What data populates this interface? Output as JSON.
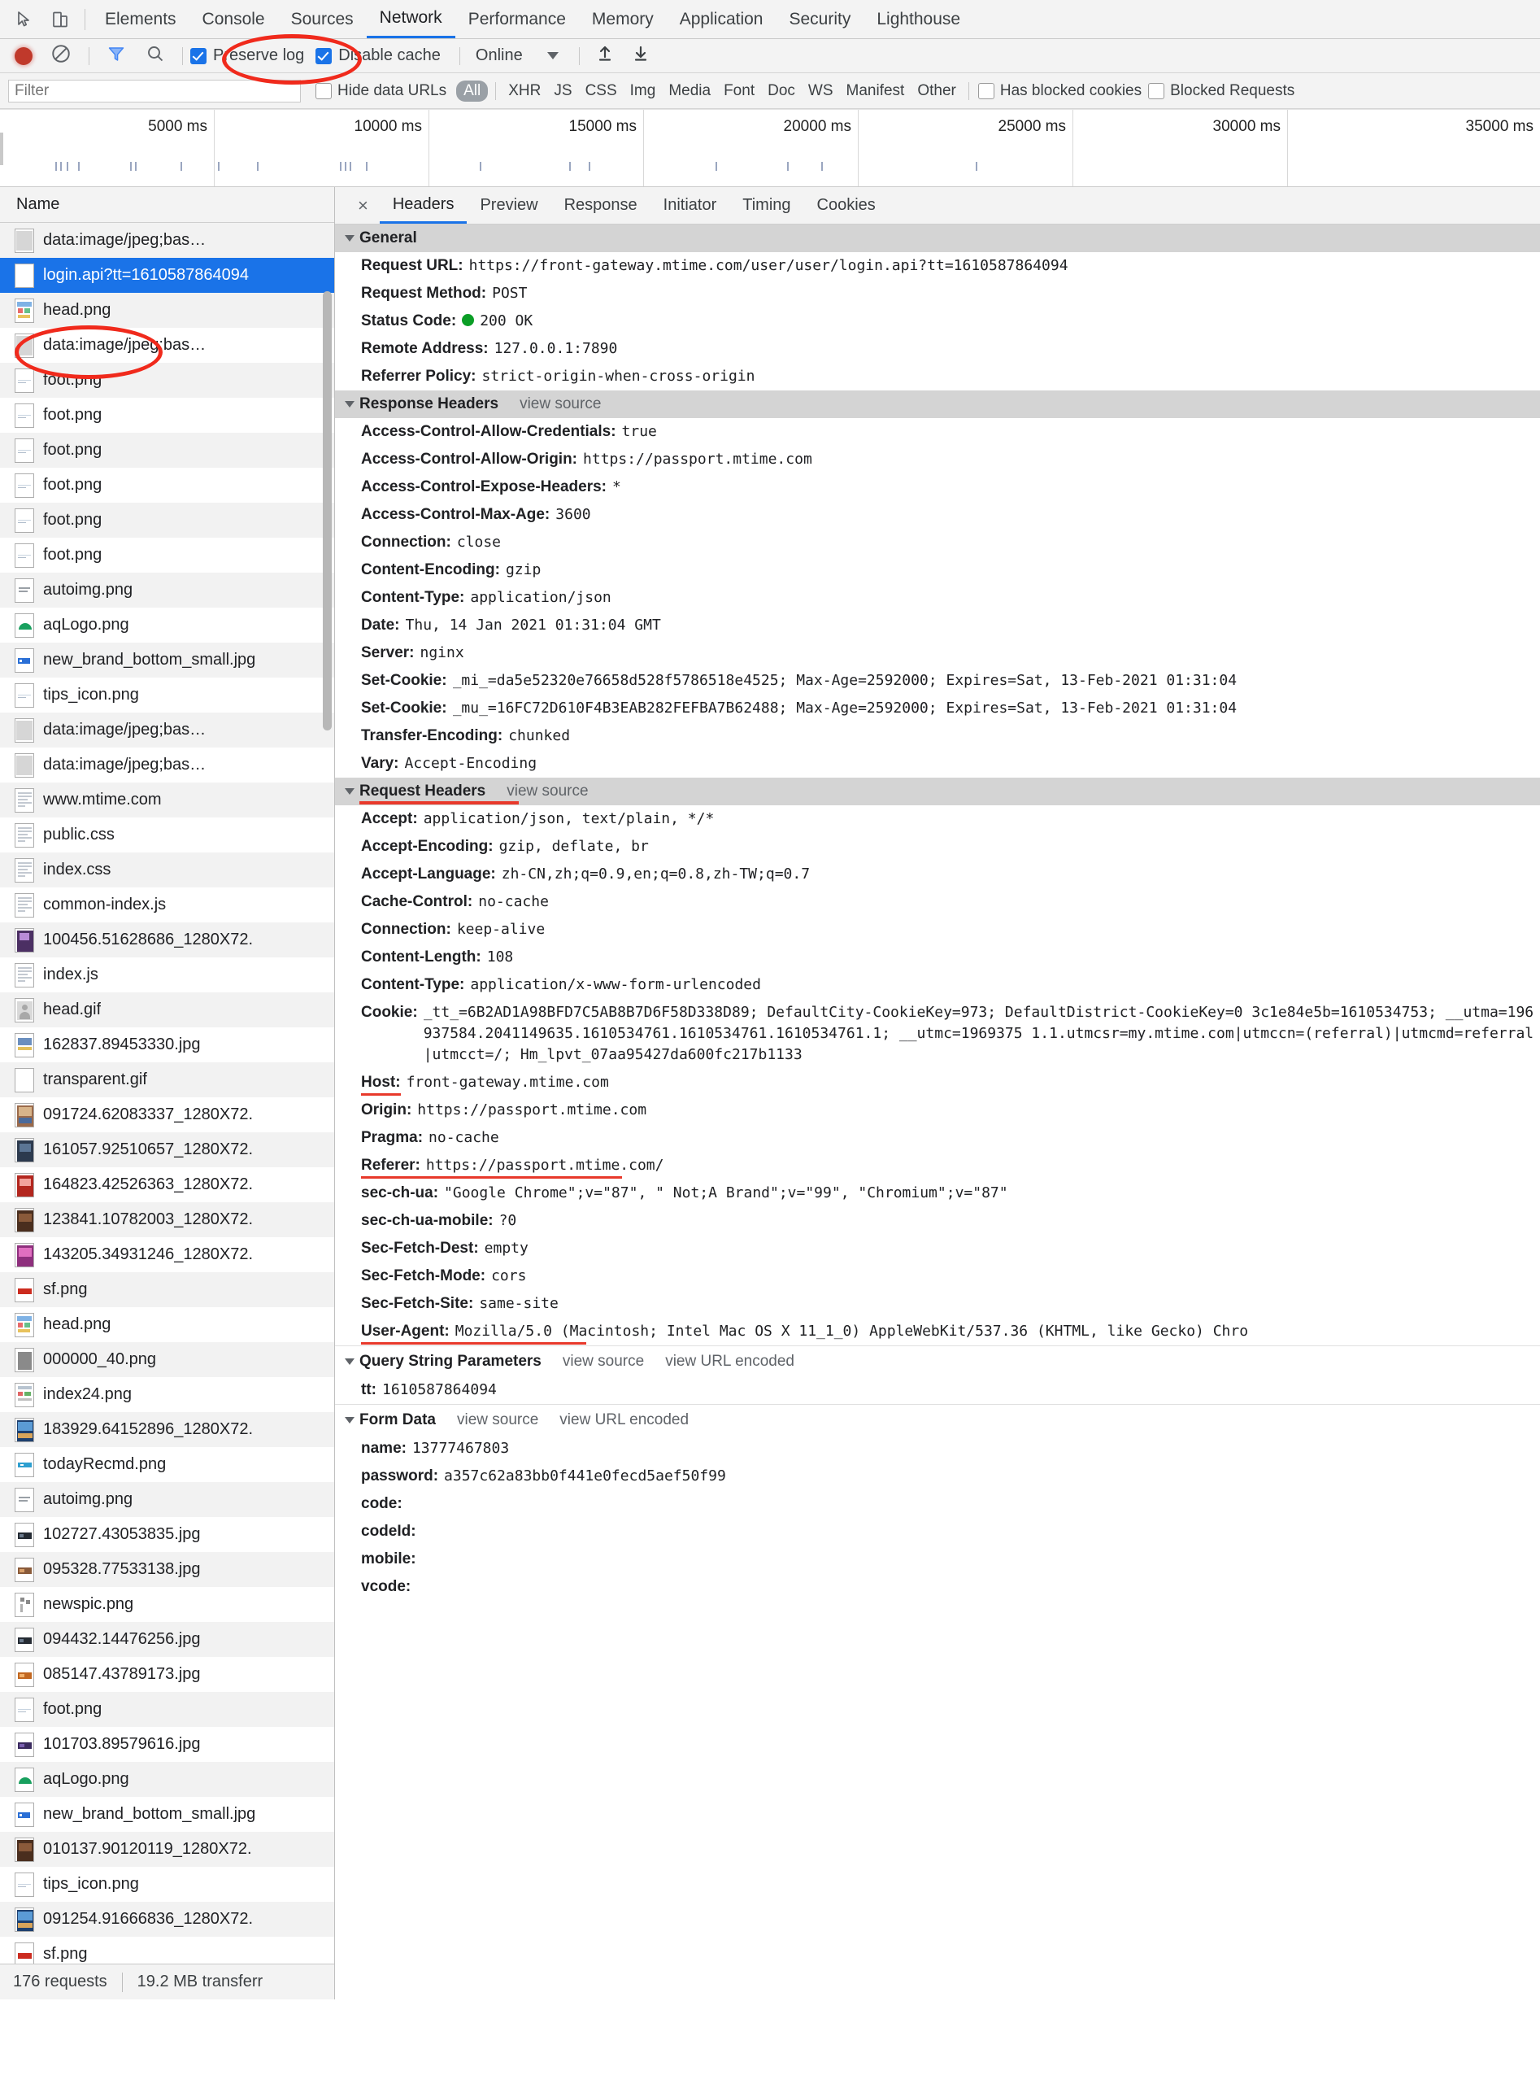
{
  "devtools": {
    "tabs": [
      {
        "label": "Elements",
        "active": false
      },
      {
        "label": "Console",
        "active": false
      },
      {
        "label": "Sources",
        "active": false
      },
      {
        "label": "Network",
        "active": true
      },
      {
        "label": "Performance",
        "active": false
      },
      {
        "label": "Memory",
        "active": false
      },
      {
        "label": "Application",
        "active": false
      },
      {
        "label": "Security",
        "active": false
      },
      {
        "label": "Lighthouse",
        "active": false
      }
    ]
  },
  "controls": {
    "record_title": "Record",
    "clear_title": "Clear",
    "filter_title": "Filter",
    "search_title": "Search",
    "preserve_log": {
      "label": "Preserve log",
      "checked": true
    },
    "disable_cache": {
      "label": "Disable cache",
      "checked": true
    },
    "throttle": "Online",
    "import_title": "Import HAR",
    "export_title": "Export HAR"
  },
  "filterbar": {
    "placeholder": "Filter",
    "value": "",
    "hide_data_urls": {
      "label": "Hide data URLs",
      "checked": false
    },
    "types": [
      "All",
      "XHR",
      "JS",
      "CSS",
      "Img",
      "Media",
      "Font",
      "Doc",
      "WS",
      "Manifest",
      "Other"
    ],
    "active_type": "All",
    "has_blocked_cookies": {
      "label": "Has blocked cookies",
      "checked": false
    },
    "blocked_requests": {
      "label": "Blocked Requests",
      "checked": false
    }
  },
  "overview": {
    "ticks": [
      "5000 ms",
      "10000 ms",
      "15000 ms",
      "20000 ms",
      "25000 ms",
      "30000 ms",
      "35000 ms"
    ]
  },
  "requests": {
    "column_header": "Name",
    "rows": [
      {
        "name": "data:image/jpeg;bas…",
        "icon": "noise"
      },
      {
        "name": "login.api?tt=1610587864094",
        "icon": "blank",
        "selected": true
      },
      {
        "name": "head.png",
        "icon": "colorful"
      },
      {
        "name": "data:image/jpeg;bas…",
        "icon": "noise"
      },
      {
        "name": "foot.png",
        "icon": "lines"
      },
      {
        "name": "foot.png",
        "icon": "lines"
      },
      {
        "name": "foot.png",
        "icon": "lines"
      },
      {
        "name": "foot.png",
        "icon": "lines"
      },
      {
        "name": "foot.png",
        "icon": "lines"
      },
      {
        "name": "foot.png",
        "icon": "lines"
      },
      {
        "name": "autoimg.png",
        "icon": "text"
      },
      {
        "name": "aqLogo.png",
        "icon": "green"
      },
      {
        "name": "new_brand_bottom_small.jpg",
        "icon": "blue"
      },
      {
        "name": "tips_icon.png",
        "icon": "lines"
      },
      {
        "name": "data:image/jpeg;bas…",
        "icon": "noise"
      },
      {
        "name": "data:image/jpeg;bas…",
        "icon": "noise"
      },
      {
        "name": "www.mtime.com",
        "icon": "doc"
      },
      {
        "name": "public.css",
        "icon": "doc"
      },
      {
        "name": "index.css",
        "icon": "doc"
      },
      {
        "name": "common-index.js",
        "icon": "doc"
      },
      {
        "name": "100456.51628686_1280X72.",
        "icon": "poster-purple"
      },
      {
        "name": "index.js",
        "icon": "doc"
      },
      {
        "name": "head.gif",
        "icon": "avatar"
      },
      {
        "name": "162837.89453330.jpg",
        "icon": "thumb"
      },
      {
        "name": "transparent.gif",
        "icon": "blank"
      },
      {
        "name": "091724.62083337_1280X72.",
        "icon": "poster-multi"
      },
      {
        "name": "161057.92510657_1280X72.",
        "icon": "poster-dark"
      },
      {
        "name": "164823.42526363_1280X72.",
        "icon": "poster-red"
      },
      {
        "name": "123841.10782003_1280X72.",
        "icon": "poster-brown"
      },
      {
        "name": "143205.34931246_1280X72.",
        "icon": "poster-pink"
      },
      {
        "name": "sf.png",
        "icon": "red-bar"
      },
      {
        "name": "head.png",
        "icon": "colorful"
      },
      {
        "name": "000000_40.png",
        "icon": "grayblock"
      },
      {
        "name": "index24.png",
        "icon": "mixed"
      },
      {
        "name": "183929.64152896_1280X72.",
        "icon": "poster-blue"
      },
      {
        "name": "todayRecmd.png",
        "icon": "cyan-bar"
      },
      {
        "name": "autoimg.png",
        "icon": "text"
      },
      {
        "name": "102727.43053835.jpg",
        "icon": "strip-dark"
      },
      {
        "name": "095328.77533138.jpg",
        "icon": "strip-warm"
      },
      {
        "name": "newspic.png",
        "icon": "newspic"
      },
      {
        "name": "094432.14476256.jpg",
        "icon": "strip-dark"
      },
      {
        "name": "085147.43789173.jpg",
        "icon": "strip-orange"
      },
      {
        "name": "foot.png",
        "icon": "lines"
      },
      {
        "name": "101703.89579616.jpg",
        "icon": "strip-purple"
      },
      {
        "name": "aqLogo.png",
        "icon": "green"
      },
      {
        "name": "new_brand_bottom_small.jpg",
        "icon": "blue"
      },
      {
        "name": "010137.90120119_1280X72.",
        "icon": "poster-brown"
      },
      {
        "name": "tips_icon.png",
        "icon": "lines"
      },
      {
        "name": "091254.91666836_1280X72.",
        "icon": "poster-blue"
      },
      {
        "name": "sf.png",
        "icon": "red-bar"
      }
    ],
    "footer": {
      "requests": "176 requests",
      "transferred": "19.2 MB transferr"
    }
  },
  "detail": {
    "close_label": "×",
    "tabs": [
      {
        "label": "Headers",
        "active": true
      },
      {
        "label": "Preview",
        "active": false
      },
      {
        "label": "Response",
        "active": false
      },
      {
        "label": "Initiator",
        "active": false
      },
      {
        "label": "Timing",
        "active": false
      },
      {
        "label": "Cookies",
        "active": false
      }
    ],
    "general": {
      "title": "General",
      "items": [
        {
          "key": "Request URL:",
          "value": "https://front-gateway.mtime.com/user/user/login.api?tt=1610587864094"
        },
        {
          "key": "Request Method:",
          "value": "POST"
        },
        {
          "key": "Status Code:",
          "value": "200 OK",
          "status_dot": "#0b9e26"
        },
        {
          "key": "Remote Address:",
          "value": "127.0.0.1:7890"
        },
        {
          "key": "Referrer Policy:",
          "value": "strict-origin-when-cross-origin"
        }
      ]
    },
    "response_headers": {
      "title": "Response Headers",
      "view_source": "view source",
      "items": [
        {
          "key": "Access-Control-Allow-Credentials:",
          "value": "true"
        },
        {
          "key": "Access-Control-Allow-Origin:",
          "value": "https://passport.mtime.com"
        },
        {
          "key": "Access-Control-Expose-Headers:",
          "value": "*"
        },
        {
          "key": "Access-Control-Max-Age:",
          "value": "3600"
        },
        {
          "key": "Connection:",
          "value": "close"
        },
        {
          "key": "Content-Encoding:",
          "value": "gzip"
        },
        {
          "key": "Content-Type:",
          "value": "application/json"
        },
        {
          "key": "Date:",
          "value": "Thu, 14 Jan 2021 01:31:04 GMT"
        },
        {
          "key": "Server:",
          "value": "nginx"
        },
        {
          "key": "Set-Cookie:",
          "value": "_mi_=da5e52320e76658d528f5786518e4525; Max-Age=2592000; Expires=Sat, 13-Feb-2021 01:31:04"
        },
        {
          "key": "Set-Cookie:",
          "value": "_mu_=16FC72D610F4B3EAB282FEFBA7B62488; Max-Age=2592000; Expires=Sat, 13-Feb-2021 01:31:04"
        },
        {
          "key": "Transfer-Encoding:",
          "value": "chunked"
        },
        {
          "key": "Vary:",
          "value": "Accept-Encoding"
        }
      ]
    },
    "request_headers": {
      "title": "Request Headers",
      "view_source": "view source",
      "underlined_title": true,
      "items": [
        {
          "key": "Accept:",
          "value": "application/json, text/plain, */*"
        },
        {
          "key": "Accept-Encoding:",
          "value": "gzip, deflate, br"
        },
        {
          "key": "Accept-Language:",
          "value": "zh-CN,zh;q=0.9,en;q=0.8,zh-TW;q=0.7"
        },
        {
          "key": "Cache-Control:",
          "value": "no-cache"
        },
        {
          "key": "Connection:",
          "value": "keep-alive"
        },
        {
          "key": "Content-Length:",
          "value": "108"
        },
        {
          "key": "Content-Type:",
          "value": "application/x-www-form-urlencoded"
        },
        {
          "key": "Cookie:",
          "value": "_tt_=6B2AD1A98BFD7C5AB8B7D6F58D338D89; DefaultCity-CookieKey=973; DefaultDistrict-CookieKey=0\n3c1e84e5b=1610534753; __utma=196937584.2041149635.1610534761.1610534761.1610534761.1; __utmc=1969375\n1.1.utmcsr=my.mtime.com|utmccn=(referral)|utmcmd=referral|utmcct=/; Hm_lpvt_07aa95427da600fc217b1133",
          "multiline": true
        },
        {
          "key": "Host:",
          "value": "front-gateway.mtime.com",
          "underline": "short"
        },
        {
          "key": "Origin:",
          "value": "https://passport.mtime.com"
        },
        {
          "key": "Pragma:",
          "value": "no-cache"
        },
        {
          "key": "Referer:",
          "value": "https://passport.mtime.com/",
          "underline": "ref"
        },
        {
          "key": "sec-ch-ua:",
          "value": "\"Google Chrome\";v=\"87\", \" Not;A Brand\";v=\"99\", \"Chromium\";v=\"87\""
        },
        {
          "key": "sec-ch-ua-mobile:",
          "value": "?0"
        },
        {
          "key": "Sec-Fetch-Dest:",
          "value": "empty"
        },
        {
          "key": "Sec-Fetch-Mode:",
          "value": "cors"
        },
        {
          "key": "Sec-Fetch-Site:",
          "value": "same-site"
        },
        {
          "key": "User-Agent:",
          "value": "Mozilla/5.0 (Macintosh; Intel Mac OS X 11_1_0) AppleWebKit/537.36 (KHTML, like Gecko) Chro",
          "underline": "ua"
        }
      ]
    },
    "query_string": {
      "title": "Query String Parameters",
      "view_source": "view source",
      "view_url_encoded": "view URL encoded",
      "items": [
        {
          "key": "tt:",
          "value": "1610587864094"
        }
      ]
    },
    "form_data": {
      "title": "Form Data",
      "view_source": "view source",
      "view_url_encoded": "view URL encoded",
      "items": [
        {
          "key": "name:",
          "value": "13777467803"
        },
        {
          "key": "password:",
          "value": "a357c62a83bb0f441e0fecd5aef50f99"
        },
        {
          "key": "code:",
          "value": ""
        },
        {
          "key": "codeId:",
          "value": ""
        },
        {
          "key": "mobile:",
          "value": ""
        },
        {
          "key": "vcode:",
          "value": ""
        }
      ]
    }
  },
  "annotations": {
    "accent_red": "#f02a1c",
    "highlight_blue": "#1a73e8"
  }
}
